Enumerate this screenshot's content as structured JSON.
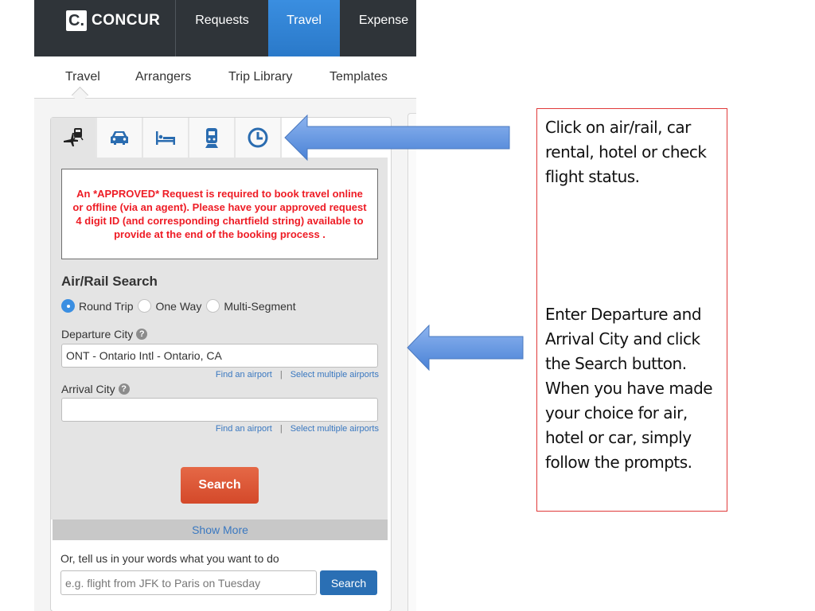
{
  "app": {
    "logo_glyph": "C.",
    "logo_text": "CONCUR",
    "top_nav": [
      {
        "label": "Requests",
        "active": false
      },
      {
        "label": "Travel",
        "active": true
      },
      {
        "label": "Expense",
        "active": false
      }
    ],
    "sub_nav": [
      {
        "label": "Travel",
        "active": true
      },
      {
        "label": "Arrangers"
      },
      {
        "label": "Trip Library"
      },
      {
        "label": "Templates"
      }
    ]
  },
  "booking": {
    "tabs": [
      {
        "icon": "air-rail-icon",
        "label": "Air/Rail",
        "active": true
      },
      {
        "icon": "car-icon",
        "label": "Car"
      },
      {
        "icon": "hotel-bed-icon",
        "label": "Hotel"
      },
      {
        "icon": "train-icon",
        "label": "Rail"
      },
      {
        "icon": "clock-icon",
        "label": "Flight Status"
      }
    ],
    "notice": "An *APPROVED* Request is required to book travel online or offline (via an agent). Please have your approved request 4 digit ID (and corresponding chartfield string) available to provide at the end of the booking process .",
    "section_title": "Air/Rail Search",
    "trip_types": [
      {
        "label": "Round Trip",
        "selected": true
      },
      {
        "label": "One Way",
        "selected": false
      },
      {
        "label": "Multi-Segment",
        "selected": false
      }
    ],
    "departure": {
      "label": "Departure City",
      "help": "?",
      "value": "ONT - Ontario Intl - Ontario, CA"
    },
    "arrival": {
      "label": "Arrival City",
      "help": "?",
      "value": ""
    },
    "links": {
      "find_airport": "Find an airport",
      "separator": "|",
      "multiple_airports": "Select multiple airports"
    },
    "search_label": "Search",
    "show_more": "Show More",
    "nl_prompt": "Or, tell us in your words what you want to do",
    "nl_placeholder": "e.g. flight from JFK to Paris on Tuesday",
    "nl_search_label": "Search"
  },
  "annotations": {
    "callout_1": "Click on air/rail, car rental, hotel or check flight status.",
    "callout_2": "Enter Departure and Arrival City and click the Search button. When you have made your choice for air, hotel or car, simply follow the prompts.",
    "arrow_color": "#5b8fdc",
    "callout_border": "#e03a3a"
  },
  "colors": {
    "topbar": "#2f3439",
    "active_tab": "#2a7fd4",
    "notice_text": "#ee1c25",
    "search_button": "#dc5535",
    "link": "#3a78c0",
    "icon_blue": "#2a6cb0"
  }
}
